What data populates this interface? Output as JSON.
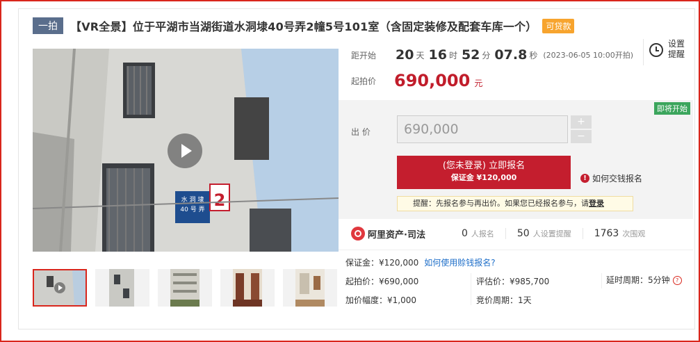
{
  "header": {
    "tag": "一拍",
    "title": "【VR全景】位于平湖市当湖街道水洞埭40号弄2幢5号101室（含固定装修及配套车库一个）",
    "loan_badge": "可贷款"
  },
  "gallery": {
    "main_photo_sign_line1": "水 洞 埭",
    "main_photo_sign_line2": "40 号 弄",
    "main_photo_sign_number": "2",
    "thumbnails": [
      "photo-1",
      "photo-2",
      "photo-3",
      "photo-4",
      "photo-5"
    ]
  },
  "countdown": {
    "label": "距开始",
    "days": "20",
    "days_unit": "天",
    "hours": "16",
    "hours_unit": "时",
    "minutes": "52",
    "minutes_unit": "分",
    "seconds": "07.8",
    "seconds_unit": "秒",
    "start_time": "(2023-06-05 10:00开拍)"
  },
  "reminder": {
    "label": "设置提醒"
  },
  "starting": {
    "label": "起拍价",
    "price": "690,000",
    "unit": "元"
  },
  "bid": {
    "status_badge": "即将开始",
    "label": "出 价",
    "input_value": "690,000",
    "plus": "+",
    "minus": "−",
    "signup_main": "(您未登录) 立即报名",
    "signup_sub": "保证金 ¥120,000",
    "howto": "如何交钱报名",
    "notice_text": "提醒：先报名参与再出价。如果您已经报名参与，请",
    "notice_link": "登录"
  },
  "stats": {
    "brand": "阿里资产·司法",
    "items": [
      {
        "num": "0",
        "label": "人报名"
      },
      {
        "num": "50",
        "label": "人设置提醒"
      },
      {
        "num": "1763",
        "label": "次围观"
      }
    ]
  },
  "details": {
    "deposit": "保证金：¥120,000",
    "deposit_link": "如何使用赊钱报名?",
    "start_price": "起拍价：¥690,000",
    "appraisal": "评估价：¥985,700",
    "delay": "延时周期：5分钟",
    "increment": "加价幅度：¥1,000",
    "bid_cycle": "竞价周期：1天"
  },
  "colors": {
    "accent": "#c41e2e",
    "badge_orange": "#f7a42e",
    "badge_green": "#3ba55c",
    "tag_blue": "#5a6e8c",
    "link": "#1f6fc9"
  }
}
